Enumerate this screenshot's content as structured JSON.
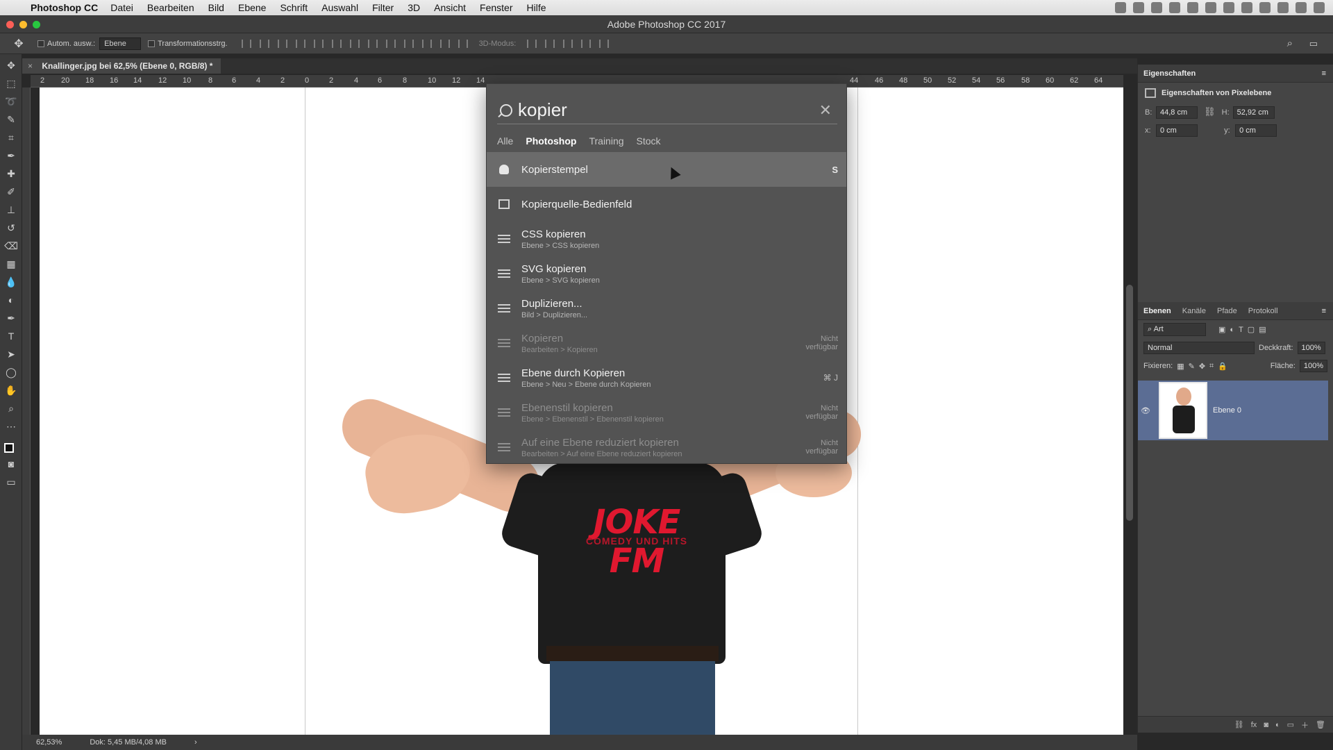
{
  "menubar": {
    "app": "Photoshop CC",
    "items": [
      "Datei",
      "Bearbeiten",
      "Bild",
      "Ebene",
      "Schrift",
      "Auswahl",
      "Filter",
      "3D",
      "Ansicht",
      "Fenster",
      "Hilfe"
    ]
  },
  "window": {
    "title": "Adobe Photoshop CC 2017"
  },
  "options": {
    "auto_select": "Autom. ausw.:",
    "layer_select": "Ebene",
    "transform": "Transformationsstrg.",
    "mode3d": "3D-Modus:"
  },
  "document": {
    "tab_title": "Knallinger.jpg bei 62,5% (Ebene 0, RGB/8) *"
  },
  "ruler": [
    "2",
    "20",
    "18",
    "16",
    "14",
    "12",
    "10",
    "8",
    "6",
    "4",
    "2",
    "0",
    "2",
    "4",
    "6",
    "8",
    "10",
    "12",
    "14",
    "44",
    "46",
    "48",
    "50",
    "52",
    "54",
    "56",
    "58",
    "60",
    "62",
    "64"
  ],
  "canvas": {
    "logo": "JOKE FM",
    "logo_sub": "COMEDY UND HITS"
  },
  "search": {
    "query": "kopier",
    "tabs": [
      "Alle",
      "Photoshop",
      "Training",
      "Stock"
    ],
    "results": [
      {
        "label": "Kopierstempel",
        "path": "",
        "shortcut": "S",
        "note": ""
      },
      {
        "label": "Kopierquelle-Bedienfeld",
        "path": "",
        "shortcut": "",
        "note": ""
      },
      {
        "label": "CSS kopieren",
        "path": "Ebene > CSS kopieren",
        "shortcut": "",
        "note": ""
      },
      {
        "label": "SVG kopieren",
        "path": "Ebene > SVG kopieren",
        "shortcut": "",
        "note": ""
      },
      {
        "label": "Duplizieren...",
        "path": "Bild > Duplizieren...",
        "shortcut": "",
        "note": ""
      },
      {
        "label": "Kopieren",
        "path": "Bearbeiten > Kopieren",
        "shortcut": "",
        "note": "Nicht verfügbar"
      },
      {
        "label": "Ebene durch Kopieren",
        "path": "Ebene > Neu > Ebene durch Kopieren",
        "shortcut": "⌘ J",
        "note": ""
      },
      {
        "label": "Ebenenstil kopieren",
        "path": "Ebene > Ebenenstil > Ebenenstil kopieren",
        "shortcut": "",
        "note": "Nicht verfügbar"
      },
      {
        "label": "Auf eine Ebene reduziert kopieren",
        "path": "Bearbeiten > Auf eine Ebene reduziert kopieren",
        "shortcut": "",
        "note": "Nicht verfügbar"
      }
    ]
  },
  "properties": {
    "title": "Eigenschaften",
    "subtitle": "Eigenschaften von Pixelebene",
    "b_label": "B:",
    "b_val": "44,8 cm",
    "h_label": "H:",
    "h_val": "52,92 cm",
    "x_label": "x:",
    "x_val": "0 cm",
    "y_label": "y:",
    "y_val": "0 cm"
  },
  "layers": {
    "tabs": [
      "Ebenen",
      "Kanäle",
      "Pfade",
      "Protokoll"
    ],
    "filter": "Art",
    "blend": "Normal",
    "opacity_label": "Deckkraft:",
    "opacity": "100%",
    "lock_label": "Fixieren:",
    "fill_label": "Fläche:",
    "fill": "100%",
    "layer_name": "Ebene 0"
  },
  "status": {
    "zoom": "62,53%",
    "doc": "Dok: 5,45 MB/4,08 MB"
  }
}
